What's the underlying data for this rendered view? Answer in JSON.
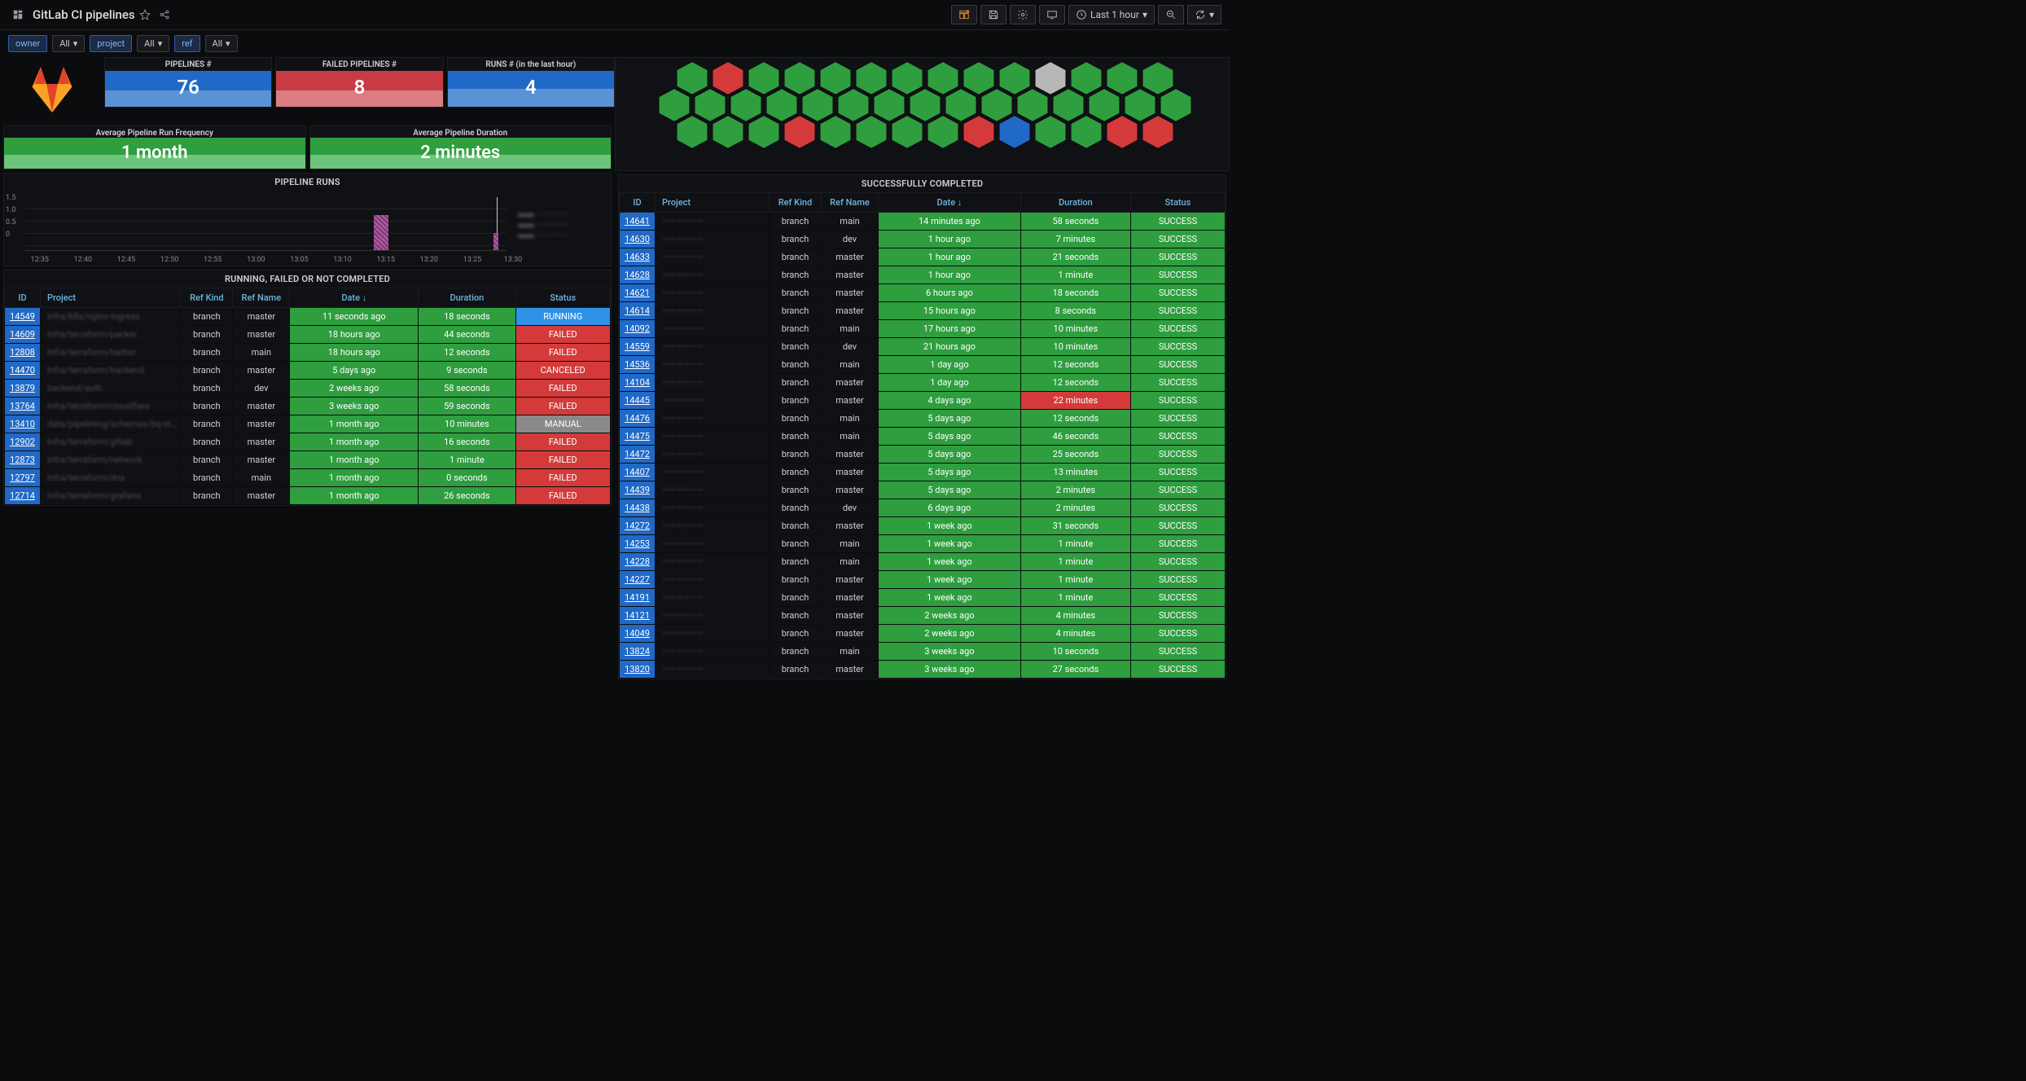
{
  "header": {
    "title": "GitLab CI pipelines",
    "time_range": "Last 1 hour"
  },
  "vars": {
    "owner_label": "owner",
    "owner_value": "All",
    "project_label": "project",
    "project_value": "All",
    "ref_label": "ref",
    "ref_value": "All"
  },
  "stats": {
    "pipelines": {
      "title": "PIPELINES #",
      "value": "76"
    },
    "failed": {
      "title": "FAILED PIPELINES #",
      "value": "8"
    },
    "runs": {
      "title": "RUNS # (in the last hour)",
      "value": "4"
    },
    "avg_freq": {
      "title": "Average Pipeline Run Frequency",
      "value": "1 month"
    },
    "avg_dur": {
      "title": "Average Pipeline Duration",
      "value": "2 minutes"
    }
  },
  "runs_panel": {
    "title": "PIPELINE RUNS",
    "y": [
      "1.5",
      "1.0",
      "0.5",
      "0"
    ],
    "x": [
      "12:35",
      "12:40",
      "12:45",
      "12:50",
      "12:55",
      "13:00",
      "13:05",
      "13:10",
      "13:15",
      "13:20",
      "13:25",
      "13:30"
    ]
  },
  "failed_panel": {
    "title": "RUNNING, FAILED OR NOT COMPLETED",
    "cols": [
      "ID",
      "Project",
      "Ref Kind",
      "Ref Name",
      "Date ↓",
      "Duration",
      "Status"
    ],
    "rows": [
      {
        "id": "14549",
        "project": "infra/k8s/nginx-ingress",
        "kind": "branch",
        "ref": "master",
        "date": "11 seconds ago",
        "dur": "18 seconds",
        "status": "RUNNING",
        "scls": "blue"
      },
      {
        "id": "14609",
        "project": "infra/terraform/packer",
        "kind": "branch",
        "ref": "master",
        "date": "18 hours ago",
        "dur": "44 seconds",
        "status": "FAILED",
        "scls": "red"
      },
      {
        "id": "12808",
        "project": "infra/terraform/harbor",
        "kind": "branch",
        "ref": "main",
        "date": "18 hours ago",
        "dur": "12 seconds",
        "status": "FAILED",
        "scls": "red"
      },
      {
        "id": "14470",
        "project": "infra/terraform/backend",
        "kind": "branch",
        "ref": "master",
        "date": "5 days ago",
        "dur": "9 seconds",
        "status": "CANCELED",
        "scls": "red"
      },
      {
        "id": "13879",
        "project": "backend/auth",
        "kind": "branch",
        "ref": "dev",
        "date": "2 weeks ago",
        "dur": "58 seconds",
        "status": "FAILED",
        "scls": "red"
      },
      {
        "id": "13764",
        "project": "infra/terraform/cloudflare",
        "kind": "branch",
        "ref": "master",
        "date": "3 weeks ago",
        "dur": "59 seconds",
        "status": "FAILED",
        "scls": "red"
      },
      {
        "id": "13410",
        "project": "data/pipelining/schemas/bq-st…",
        "kind": "branch",
        "ref": "master",
        "date": "1 month ago",
        "dur": "10 minutes",
        "status": "MANUAL",
        "scls": "gray"
      },
      {
        "id": "12902",
        "project": "infra/terraform/gitlab",
        "kind": "branch",
        "ref": "master",
        "date": "1 month ago",
        "dur": "16 seconds",
        "status": "FAILED",
        "scls": "red"
      },
      {
        "id": "12873",
        "project": "infra/terraform/network",
        "kind": "branch",
        "ref": "master",
        "date": "1 month ago",
        "dur": "1 minute",
        "status": "FAILED",
        "scls": "red"
      },
      {
        "id": "12797",
        "project": "infra/terraform/dns",
        "kind": "branch",
        "ref": "main",
        "date": "1 month ago",
        "dur": "0 seconds",
        "status": "FAILED",
        "scls": "red"
      },
      {
        "id": "12714",
        "project": "infra/terraform/grafana",
        "kind": "branch",
        "ref": "master",
        "date": "1 month ago",
        "dur": "26 seconds",
        "status": "FAILED",
        "scls": "red"
      }
    ]
  },
  "hex": {
    "row1": [
      "g",
      "r",
      "g",
      "g",
      "g",
      "g",
      "g",
      "g",
      "g",
      "g",
      "n",
      "g",
      "g",
      "g"
    ],
    "row2": [
      "g",
      "g",
      "g",
      "g",
      "g",
      "g",
      "g",
      "g",
      "g",
      "g",
      "g",
      "g",
      "g",
      "g",
      "g"
    ],
    "row3": [
      "g",
      "g",
      "g",
      "r",
      "g",
      "g",
      "g",
      "g",
      "r",
      "b",
      "g",
      "g",
      "r",
      "r"
    ]
  },
  "success_panel": {
    "title": "SUCCESSFULLY COMPLETED",
    "cols": [
      "ID",
      "Project",
      "Ref Kind",
      "Ref Name",
      "Date ↓",
      "Duration",
      "Status"
    ],
    "rows": [
      {
        "id": "14641",
        "kind": "branch",
        "ref": "main",
        "date": "14 minutes ago",
        "dur": "58 seconds",
        "dcls": "green"
      },
      {
        "id": "14630",
        "kind": "branch",
        "ref": "dev",
        "date": "1 hour ago",
        "dur": "7 minutes",
        "dcls": "green"
      },
      {
        "id": "14633",
        "kind": "branch",
        "ref": "master",
        "date": "1 hour ago",
        "dur": "21 seconds",
        "dcls": "green"
      },
      {
        "id": "14628",
        "kind": "branch",
        "ref": "master",
        "date": "1 hour ago",
        "dur": "1 minute",
        "dcls": "green"
      },
      {
        "id": "14621",
        "kind": "branch",
        "ref": "master",
        "date": "6 hours ago",
        "dur": "18 seconds",
        "dcls": "green"
      },
      {
        "id": "14614",
        "kind": "branch",
        "ref": "master",
        "date": "15 hours ago",
        "dur": "8 seconds",
        "dcls": "green"
      },
      {
        "id": "14092",
        "kind": "branch",
        "ref": "main",
        "date": "17 hours ago",
        "dur": "10 minutes",
        "dcls": "green"
      },
      {
        "id": "14559",
        "kind": "branch",
        "ref": "dev",
        "date": "21 hours ago",
        "dur": "10 minutes",
        "dcls": "green"
      },
      {
        "id": "14536",
        "kind": "branch",
        "ref": "main",
        "date": "1 day ago",
        "dur": "12 seconds",
        "dcls": "green"
      },
      {
        "id": "14104",
        "kind": "branch",
        "ref": "master",
        "date": "1 day ago",
        "dur": "12 seconds",
        "dcls": "green"
      },
      {
        "id": "14445",
        "kind": "branch",
        "ref": "master",
        "date": "4 days ago",
        "dur": "22 minutes",
        "dcls": "red"
      },
      {
        "id": "14476",
        "kind": "branch",
        "ref": "main",
        "date": "5 days ago",
        "dur": "12 seconds",
        "dcls": "green"
      },
      {
        "id": "14475",
        "kind": "branch",
        "ref": "main",
        "date": "5 days ago",
        "dur": "46 seconds",
        "dcls": "green"
      },
      {
        "id": "14472",
        "kind": "branch",
        "ref": "master",
        "date": "5 days ago",
        "dur": "25 seconds",
        "dcls": "green"
      },
      {
        "id": "14407",
        "kind": "branch",
        "ref": "master",
        "date": "5 days ago",
        "dur": "13 minutes",
        "dcls": "green"
      },
      {
        "id": "14439",
        "kind": "branch",
        "ref": "master",
        "date": "5 days ago",
        "dur": "2 minutes",
        "dcls": "green"
      },
      {
        "id": "14438",
        "kind": "branch",
        "ref": "dev",
        "date": "6 days ago",
        "dur": "2 minutes",
        "dcls": "green"
      },
      {
        "id": "14272",
        "kind": "branch",
        "ref": "master",
        "date": "1 week ago",
        "dur": "31 seconds",
        "dcls": "green"
      },
      {
        "id": "14253",
        "kind": "branch",
        "ref": "main",
        "date": "1 week ago",
        "dur": "1 minute",
        "dcls": "green"
      },
      {
        "id": "14228",
        "kind": "branch",
        "ref": "main",
        "date": "1 week ago",
        "dur": "1 minute",
        "dcls": "green"
      },
      {
        "id": "14227",
        "kind": "branch",
        "ref": "master",
        "date": "1 week ago",
        "dur": "1 minute",
        "dcls": "green"
      },
      {
        "id": "14191",
        "kind": "branch",
        "ref": "master",
        "date": "1 week ago",
        "dur": "1 minute",
        "dcls": "green"
      },
      {
        "id": "14121",
        "kind": "branch",
        "ref": "master",
        "date": "2 weeks ago",
        "dur": "4 minutes",
        "dcls": "green"
      },
      {
        "id": "14049",
        "kind": "branch",
        "ref": "master",
        "date": "2 weeks ago",
        "dur": "4 minutes",
        "dcls": "green"
      },
      {
        "id": "13824",
        "kind": "branch",
        "ref": "main",
        "date": "3 weeks ago",
        "dur": "10 seconds",
        "dcls": "green"
      },
      {
        "id": "13820",
        "kind": "branch",
        "ref": "master",
        "date": "3 weeks ago",
        "dur": "27 seconds",
        "dcls": "green"
      }
    ]
  },
  "chart_data": {
    "type": "bar",
    "title": "PIPELINE RUNS",
    "xlabel": "",
    "ylabel": "",
    "ylim": [
      0,
      1.5
    ],
    "x_ticks": [
      "12:35",
      "12:40",
      "12:45",
      "12:50",
      "12:55",
      "13:00",
      "13:05",
      "13:10",
      "13:15",
      "13:20",
      "13:25",
      "13:30"
    ],
    "series": [
      {
        "name": "runs",
        "x": [
          "13:15",
          "13:15",
          "13:16",
          "13:29"
        ],
        "values": [
          1,
          1,
          1,
          1
        ]
      }
    ]
  }
}
